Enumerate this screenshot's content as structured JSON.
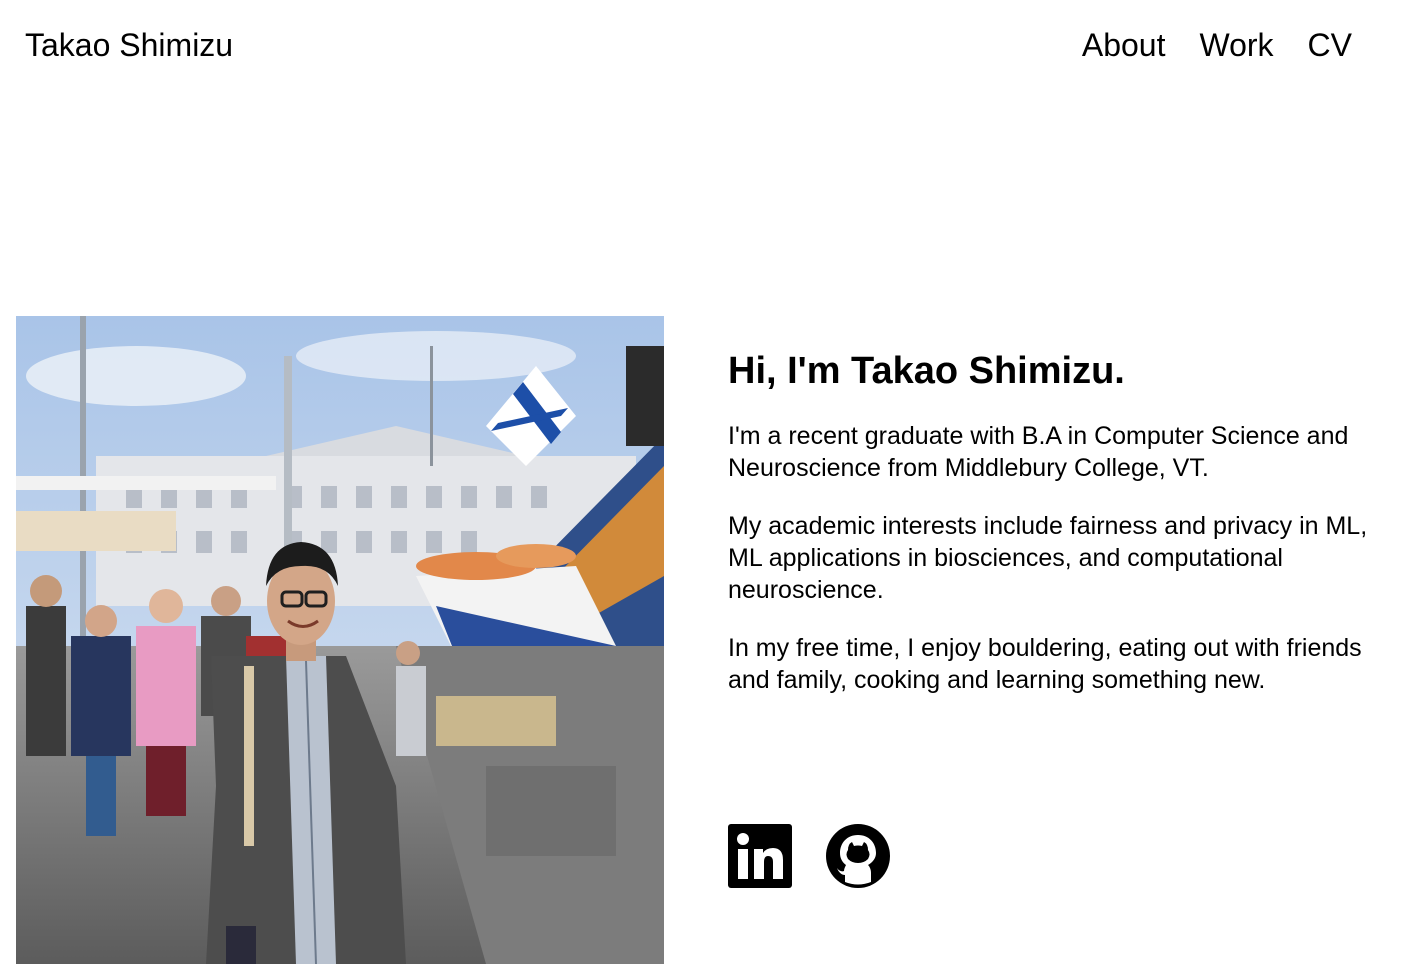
{
  "header": {
    "site_title": "Takao Shimizu",
    "nav": [
      {
        "label": "About"
      },
      {
        "label": "Work"
      },
      {
        "label": "CV"
      }
    ]
  },
  "main": {
    "photo_icon": "portrait-photo",
    "heading": "Hi, I'm Takao Shimizu.",
    "paragraphs": [
      "I'm a recent graduate with B.A in Computer Science and Neuroscience from Middlebury College, VT.",
      "My academic interests include fairness and privacy in ML, ML applications in biosciences, and computational neuroscience.",
      "In my free time, I enjoy bouldering, eating out with friends and family, cooking and learning something new."
    ],
    "social": [
      {
        "icon": "linkedin-icon"
      },
      {
        "icon": "github-icon"
      }
    ]
  },
  "colors": {
    "text": "#000000",
    "background": "#ffffff"
  }
}
